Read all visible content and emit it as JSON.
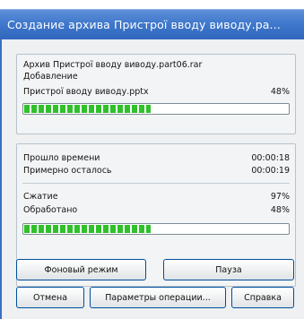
{
  "window": {
    "title": "Создание архива Пристрої вводу виводу.ра..."
  },
  "archive": {
    "name": "Архив Пристрої вводу виводу.part06.rar",
    "action": "Добавление",
    "current_file": "Пристрої вводу виводу.pptx",
    "file_percent": "48%",
    "file_progress": 0.48
  },
  "stats": {
    "elapsed_label": "Прошло времени",
    "elapsed_value": "00:00:18",
    "remaining_label": "Примерно осталось",
    "remaining_value": "00:00:19",
    "compression_label": "Сжатие",
    "compression_value": "97%",
    "processed_label": "Обработано",
    "processed_value": "48%",
    "total_progress": 0.48
  },
  "buttons": {
    "background": "Фоновый режим",
    "pause": "Пауза",
    "cancel": "Отмена",
    "options": "Параметры операции...",
    "help": "Справка"
  },
  "colors": {
    "title_bar": "#3f78cc",
    "progress": "#2fc12a",
    "button_border": "#004f9e"
  }
}
